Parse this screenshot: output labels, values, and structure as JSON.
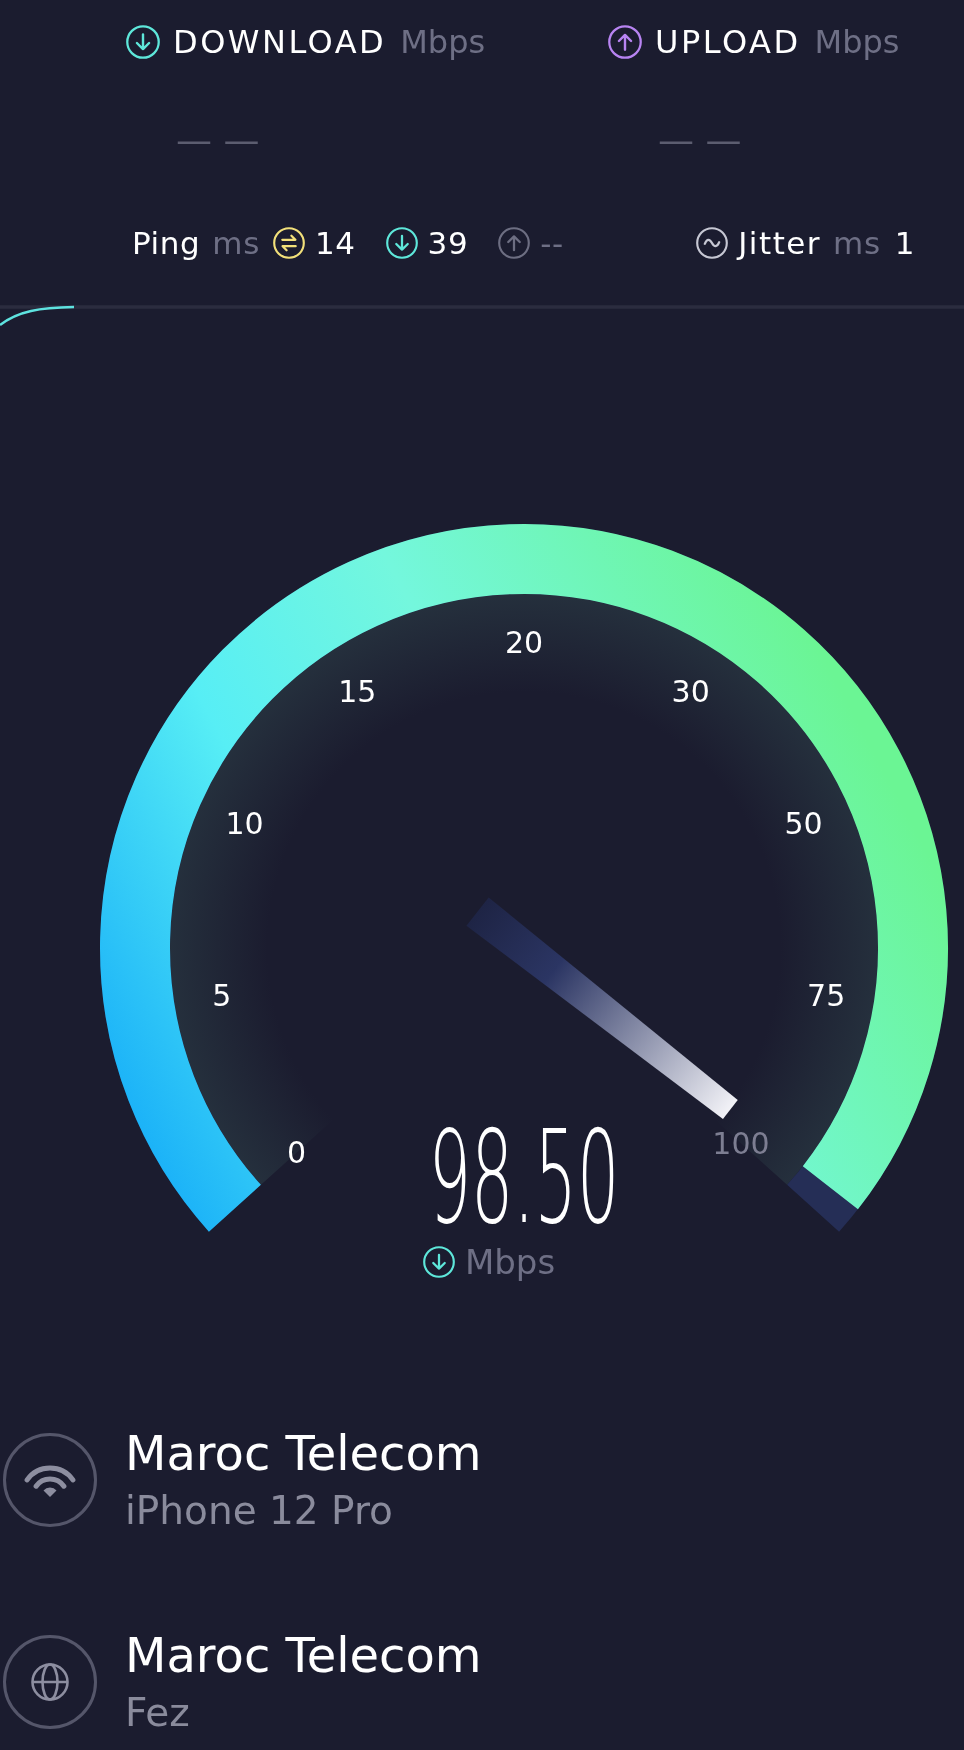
{
  "results": [
    {
      "kind": "download",
      "label": "DOWNLOAD",
      "unit": "Mbps",
      "value": "— —",
      "color": "#5ee7da"
    },
    {
      "kind": "upload",
      "label": "UPLOAD",
      "unit": "Mbps",
      "value": "— —",
      "color": "#b884f2"
    }
  ],
  "ping": {
    "label": "Ping",
    "unit": "ms",
    "readings": [
      {
        "kind": "idle",
        "color": "#f2e07a",
        "value": "14",
        "pending": false
      },
      {
        "kind": "download",
        "color": "#5ee7da",
        "value": "39",
        "pending": false
      },
      {
        "kind": "upload",
        "color": "#6d6e82",
        "value": "--",
        "pending": true
      }
    ]
  },
  "jitter": {
    "label": "Jitter",
    "unit": "ms",
    "value": "1"
  },
  "gauge": {
    "level": 0.985,
    "ticks": [
      {
        "label": "0",
        "reached": true
      },
      {
        "label": "5",
        "reached": true
      },
      {
        "label": "10",
        "reached": true
      },
      {
        "label": "15",
        "reached": true
      },
      {
        "label": "20",
        "reached": true
      },
      {
        "label": "30",
        "reached": true
      },
      {
        "label": "50",
        "reached": true
      },
      {
        "label": "75",
        "reached": true
      },
      {
        "label": "100",
        "reached": false
      }
    ],
    "value": "98.50",
    "unit": "Mbps"
  },
  "networks": [
    {
      "kind": "wifi",
      "title": "Maroc Telecom",
      "subtitle": "iPhone 12 Pro"
    },
    {
      "kind": "server",
      "title": "Maroc Telecom",
      "subtitle": "Fez"
    }
  ]
}
